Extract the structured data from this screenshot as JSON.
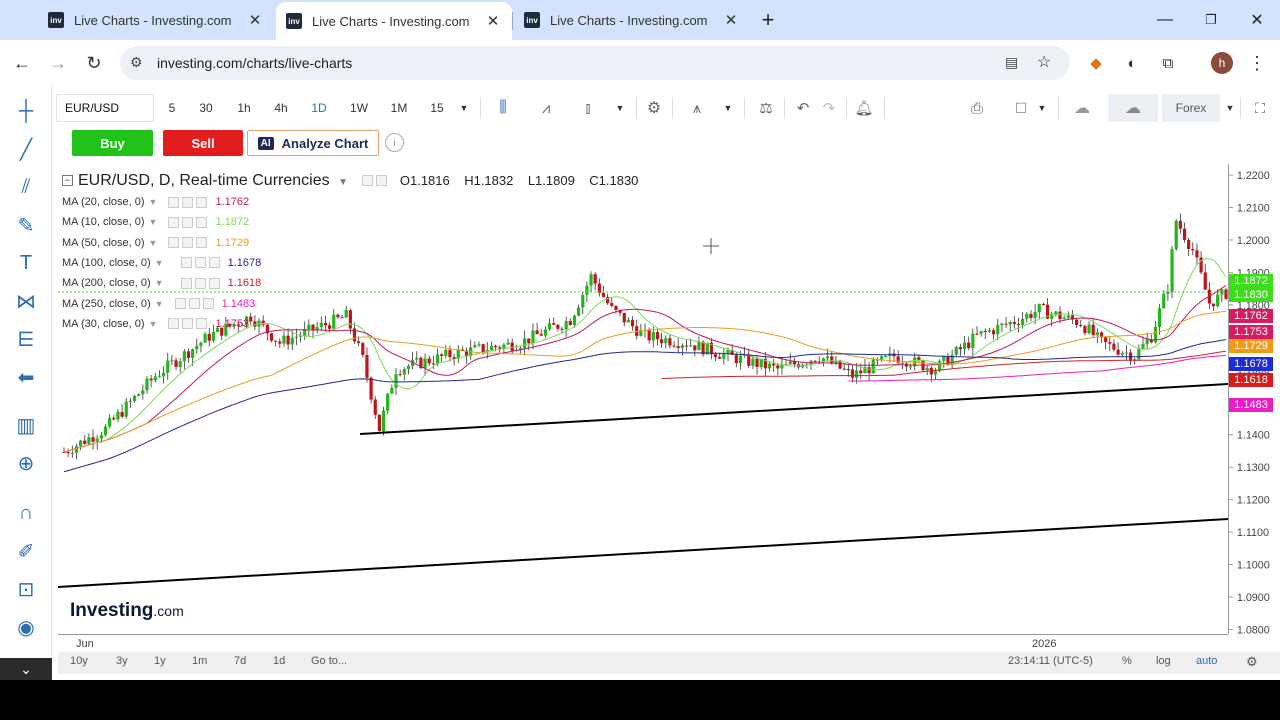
{
  "browser": {
    "tabs": [
      {
        "title": "Live Charts - Investing.com"
      },
      {
        "title": "Live Charts - Investing.com"
      },
      {
        "title": "Live Charts - Investing.com"
      }
    ],
    "url": "investing.com/charts/live-charts",
    "profile_initial": "h"
  },
  "toolbar": {
    "symbol": "EUR/USD",
    "intervals": [
      "5",
      "30",
      "1h",
      "4h",
      "1D",
      "1W",
      "1M",
      "15"
    ],
    "active_interval": "1D",
    "market": "Forex"
  },
  "actions": {
    "buy": "Buy",
    "sell": "Sell",
    "ai_badge": "AI",
    "analyze": "Analyze Chart",
    "info": "i"
  },
  "legend": {
    "title": "EUR/USD, D, Real-time Currencies",
    "ohlc": [
      "O1.1816",
      "H1.1832",
      "L1.1809",
      "C1.1830"
    ],
    "mas": [
      {
        "label": "MA (20, close, 0)",
        "value": "1.1762",
        "color": "#c2185b"
      },
      {
        "label": "MA (10, close, 0)",
        "value": "1.1872",
        "color": "#7ed957"
      },
      {
        "label": "MA (50, close, 0)",
        "value": "1.1729",
        "color": "#e6a020"
      },
      {
        "label": "MA (100, close, 0)",
        "value": "1.1678",
        "color": "#1f2a8c"
      },
      {
        "label": "MA (200, close, 0)",
        "value": "1.1618",
        "color": "#c62828"
      },
      {
        "label": "MA (250, close, 0)",
        "value": "1.1483",
        "color": "#e91ec8"
      },
      {
        "label": "MA (30, close, 0)",
        "value": "1.1753",
        "color": "#c2185b"
      }
    ]
  },
  "chart_data": {
    "type": "candlestick",
    "title": "EUR/USD, D, Real-time Currencies",
    "ylim": [
      1.08,
      1.222
    ],
    "yticks": [
      "1.2200",
      "1.2100",
      "1.2000",
      "1.1900",
      "1.1800",
      "1.1700",
      "1.1600",
      "1.1500",
      "1.1400",
      "1.1300",
      "1.1200",
      "1.1100",
      "1.1000",
      "1.0900",
      "1.0800"
    ],
    "xticks": [
      "Jun",
      "2026"
    ],
    "price_labels": [
      {
        "text": "1.1872",
        "color": "#3ddc1e"
      },
      {
        "text": "1.1830",
        "color": "#3ddc1e"
      },
      {
        "text": "1.1762",
        "color": "#d81b60"
      },
      {
        "text": "1.1753",
        "color": "#d81b60"
      },
      {
        "text": "1.1729",
        "color": "#f39c12"
      },
      {
        "text": "1.1678",
        "color": "#1e2bd8"
      },
      {
        "text": "1.1618",
        "color": "#d81b1b"
      },
      {
        "text": "1.1483",
        "color": "#e91ec8"
      }
    ],
    "last_close": 1.183,
    "watermark": "Investing.com"
  },
  "bottombar": {
    "ranges": [
      "10y",
      "3y",
      "1y",
      "1m",
      "7d",
      "1d"
    ],
    "goto": "Go to...",
    "clock": "23:14:11 (UTC-5)",
    "percent": "%",
    "log": "log",
    "auto": "auto"
  }
}
